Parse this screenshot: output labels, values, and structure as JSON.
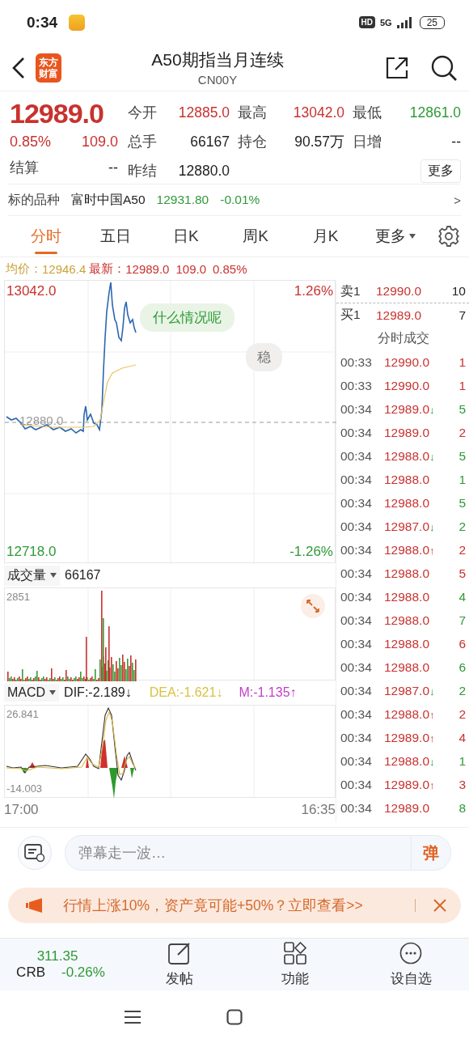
{
  "status_bar": {
    "time": "0:34",
    "hd": "HD",
    "network": "5G",
    "battery": "25"
  },
  "header": {
    "logo_text": "东方财富",
    "title": "A50期指当月连续",
    "code": "CN00Y"
  },
  "quote": {
    "price": "12989.0",
    "change_pct": "0.85%",
    "change": "109.0",
    "color": "#c8322f",
    "settle_label": "结算",
    "settle_value": "--",
    "more_button": "更多",
    "fields": [
      {
        "label": "今开",
        "value": "12885.0",
        "color": "#c8322f"
      },
      {
        "label": "最高",
        "value": "13042.0",
        "color": "#c8322f"
      },
      {
        "label": "最低",
        "value": "12861.0",
        "color": "#2f9a37"
      },
      {
        "label": "总手",
        "value": "66167",
        "color": "#222222"
      },
      {
        "label": "持仓",
        "value": "90.57万",
        "color": "#222222"
      },
      {
        "label": "日增",
        "value": "--",
        "color": "#222222"
      },
      {
        "label": "昨结",
        "value": "12880.0",
        "color": "#222222"
      }
    ]
  },
  "underlying": {
    "label": "标的品种",
    "name": "富时中国A50",
    "price": "12931.80",
    "change": "-0.01%",
    "color": "#2f9a37",
    "arrow": ">"
  },
  "tabs": [
    {
      "label": "分时",
      "selected": true
    },
    {
      "label": "五日",
      "selected": false
    },
    {
      "label": "日K",
      "selected": false
    },
    {
      "label": "周K",
      "selected": false
    },
    {
      "label": "月K",
      "selected": false
    },
    {
      "label": "更多",
      "selected": false,
      "kind": "dropdown"
    }
  ],
  "info_line": {
    "avg_label": "均价：",
    "avg": "12946.4",
    "last_label": "最新：",
    "last": "12989.0",
    "change": "109.0",
    "change_pct": "0.85%"
  },
  "price_chart": {
    "high": "13042.0",
    "high_pct": "1.26%",
    "low": "12718.0",
    "low_pct": "-1.26%",
    "prev": "12880.0",
    "comments": [
      {
        "text": "什么情况呢",
        "kind": "green"
      },
      {
        "text": "稳",
        "kind": "grey"
      }
    ]
  },
  "volume_panel": {
    "selector": "成交量",
    "value": "66167",
    "max": "2851"
  },
  "macd_panel": {
    "selector": "MACD",
    "dif": "DIF:-2.189↓",
    "dea": "DEA:-1.621↓",
    "m": "M:-1.135↑",
    "max": "26.841",
    "min": "-14.003"
  },
  "time_axis": {
    "start": "17:00",
    "end": "16:35"
  },
  "order_book": {
    "ask": {
      "label": "卖1",
      "price": "12990.0",
      "volume": "10"
    },
    "bid": {
      "label": "买1",
      "price": "12989.0",
      "volume": "7"
    },
    "title": "分时成交",
    "trades": [
      {
        "time": "00:33",
        "price": "12990.0",
        "color": "#c8322f",
        "volume": "1"
      },
      {
        "time": "00:33",
        "price": "12990.0",
        "color": "#c8322f",
        "volume": "1"
      },
      {
        "time": "00:34",
        "price": "12989.0",
        "arrow": "↓",
        "color": "#2f9a37",
        "volume": "5"
      },
      {
        "time": "00:34",
        "price": "12989.0",
        "color": "#c8322f",
        "volume": "2"
      },
      {
        "time": "00:34",
        "price": "12988.0",
        "arrow": "↓",
        "color": "#2f9a37",
        "volume": "5"
      },
      {
        "time": "00:34",
        "price": "12988.0",
        "color": "#2f9a37",
        "volume": "1"
      },
      {
        "time": "00:34",
        "price": "12988.0",
        "color": "#2f9a37",
        "volume": "5"
      },
      {
        "time": "00:34",
        "price": "12987.0",
        "arrow": "↓",
        "color": "#2f9a37",
        "volume": "2"
      },
      {
        "time": "00:34",
        "price": "12988.0",
        "arrow": "↑",
        "color": "#c8322f",
        "volume": "2"
      },
      {
        "time": "00:34",
        "price": "12988.0",
        "color": "#c8322f",
        "volume": "5"
      },
      {
        "time": "00:34",
        "price": "12988.0",
        "color": "#2f9a37",
        "volume": "4"
      },
      {
        "time": "00:34",
        "price": "12988.0",
        "color": "#2f9a37",
        "volume": "7"
      },
      {
        "time": "00:34",
        "price": "12988.0",
        "color": "#c8322f",
        "volume": "6"
      },
      {
        "time": "00:34",
        "price": "12988.0",
        "color": "#2f9a37",
        "volume": "6"
      },
      {
        "time": "00:34",
        "price": "12987.0",
        "arrow": "↓",
        "color": "#2f9a37",
        "volume": "2"
      },
      {
        "time": "00:34",
        "price": "12988.0",
        "arrow": "↑",
        "color": "#c8322f",
        "volume": "2"
      },
      {
        "time": "00:34",
        "price": "12989.0",
        "arrow": "↑",
        "color": "#c8322f",
        "volume": "4"
      },
      {
        "time": "00:34",
        "price": "12988.0",
        "arrow": "↓",
        "color": "#2f9a37",
        "volume": "1"
      },
      {
        "time": "00:34",
        "price": "12989.0",
        "arrow": "↑",
        "color": "#c8322f",
        "volume": "3"
      },
      {
        "time": "00:34",
        "price": "12989.0",
        "color": "#2f9a37",
        "volume": "8"
      }
    ]
  },
  "danmaku": {
    "placeholder": "弹幕走一波…",
    "send": "弹"
  },
  "ad_banner": {
    "text": "行情上涨10%，资产竟可能+50%？立即查看>>"
  },
  "bottom_bar": {
    "index": {
      "value": "311.35",
      "name": "CRB",
      "change": "-0.26%",
      "color": "#2f9a37"
    },
    "items": [
      {
        "label": "发帖",
        "kind": "post"
      },
      {
        "label": "功能",
        "kind": "grid"
      },
      {
        "label": "设自选",
        "kind": "more"
      }
    ]
  }
}
